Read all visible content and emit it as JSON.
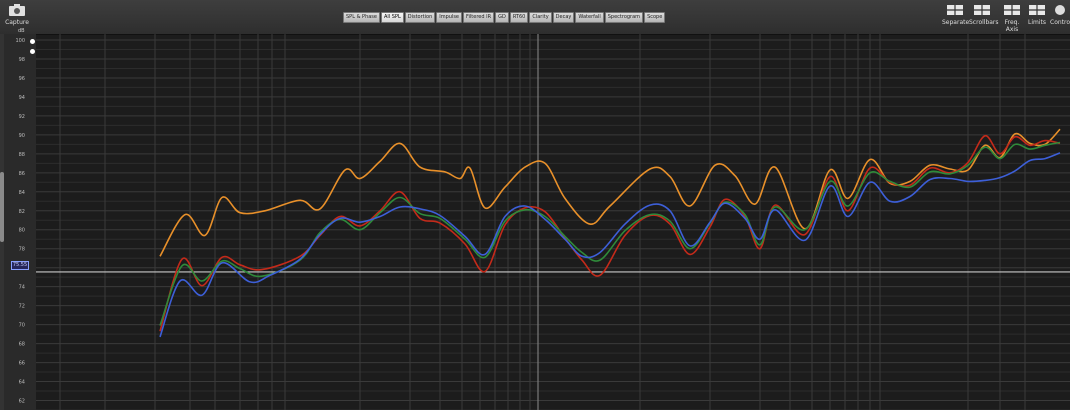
{
  "toolbar": {
    "capture_label": "Capture",
    "tabs": [
      {
        "label": "SPL & Phase"
      },
      {
        "label": "All SPL",
        "active": true
      },
      {
        "label": "Distortion"
      },
      {
        "label": "Impulse"
      },
      {
        "label": "Filtered IR"
      },
      {
        "label": "GD"
      },
      {
        "label": "RT60"
      },
      {
        "label": "Clarity"
      },
      {
        "label": "Decay"
      },
      {
        "label": "Waterfall"
      },
      {
        "label": "Spectrogram"
      },
      {
        "label": "Scope"
      }
    ],
    "right_buttons": [
      {
        "label": "Separate",
        "icon": "separate-icon"
      },
      {
        "label": "Scrollbars",
        "icon": "scrollbars-icon"
      },
      {
        "label": "Freq. Axis",
        "icon": "freq-axis-icon"
      },
      {
        "label": "Limits",
        "icon": "limits-icon"
      },
      {
        "label": "Controls",
        "icon": "controls-icon"
      }
    ]
  },
  "axis": {
    "unit": "dB",
    "ticks": [
      "100",
      "98",
      "96",
      "94",
      "92",
      "90",
      "88",
      "86",
      "84",
      "82",
      "80",
      "78",
      "76",
      "74",
      "72",
      "70",
      "68",
      "66",
      "64",
      "62"
    ],
    "ymax": 100,
    "ymin": 61,
    "cursor_value": "75.55"
  },
  "colors": {
    "orange": "#e8902a",
    "red": "#c42a1a",
    "green": "#2f8a3a",
    "blue": "#3d5fd8",
    "grid": "#3a3a3a",
    "cursor": "#c8c8c8"
  },
  "chart_data": {
    "type": "line",
    "ylabel": "dB",
    "ylim": [
      61,
      100
    ],
    "series": [
      {
        "color": "orange",
        "points": [
          [
            160,
            77.2
          ],
          [
            185,
            81.6
          ],
          [
            205,
            79.4
          ],
          [
            222,
            83.4
          ],
          [
            240,
            81.8
          ],
          [
            265,
            82
          ],
          [
            300,
            83.1
          ],
          [
            320,
            82.2
          ],
          [
            345,
            86.3
          ],
          [
            360,
            85.4
          ],
          [
            380,
            87.2
          ],
          [
            400,
            89.1
          ],
          [
            420,
            86.6
          ],
          [
            445,
            86.1
          ],
          [
            460,
            85.4
          ],
          [
            470,
            86.5
          ],
          [
            485,
            82.3
          ],
          [
            505,
            84.5
          ],
          [
            525,
            86.6
          ],
          [
            545,
            87
          ],
          [
            565,
            83.3
          ],
          [
            590,
            80.6
          ],
          [
            610,
            82.5
          ],
          [
            650,
            86.4
          ],
          [
            670,
            85.6
          ],
          [
            690,
            82.5
          ],
          [
            715,
            86.8
          ],
          [
            735,
            85.7
          ],
          [
            755,
            82.7
          ],
          [
            775,
            86.6
          ],
          [
            805,
            80.1
          ],
          [
            830,
            86.3
          ],
          [
            848,
            83.3
          ],
          [
            870,
            87.4
          ],
          [
            890,
            84.9
          ],
          [
            910,
            85.1
          ],
          [
            930,
            86.8
          ],
          [
            950,
            86.4
          ],
          [
            968,
            86.3
          ],
          [
            985,
            88.9
          ],
          [
            1000,
            87.6
          ],
          [
            1015,
            90.1
          ],
          [
            1030,
            89.1
          ],
          [
            1045,
            89
          ],
          [
            1060,
            90.6
          ]
        ]
      },
      {
        "color": "red",
        "points": [
          [
            160,
            69.3
          ],
          [
            182,
            76.9
          ],
          [
            202,
            74.1
          ],
          [
            222,
            77.1
          ],
          [
            240,
            76.3
          ],
          [
            262,
            75.8
          ],
          [
            300,
            77.2
          ],
          [
            320,
            79.4
          ],
          [
            340,
            81.4
          ],
          [
            360,
            80.4
          ],
          [
            380,
            82
          ],
          [
            400,
            84
          ],
          [
            420,
            81.2
          ],
          [
            440,
            80.7
          ],
          [
            465,
            78.5
          ],
          [
            485,
            75.6
          ],
          [
            505,
            80.5
          ],
          [
            525,
            82.3
          ],
          [
            545,
            81.9
          ],
          [
            565,
            79.1
          ],
          [
            582,
            76.8
          ],
          [
            600,
            75.2
          ],
          [
            625,
            79.4
          ],
          [
            650,
            81.5
          ],
          [
            670,
            80.6
          ],
          [
            690,
            77.4
          ],
          [
            710,
            80.3
          ],
          [
            725,
            83.2
          ],
          [
            745,
            81.4
          ],
          [
            760,
            78
          ],
          [
            775,
            82.6
          ],
          [
            805,
            79.5
          ],
          [
            830,
            85.6
          ],
          [
            848,
            82
          ],
          [
            870,
            86.5
          ],
          [
            890,
            85
          ],
          [
            910,
            84.7
          ],
          [
            930,
            86.5
          ],
          [
            950,
            86
          ],
          [
            968,
            87.1
          ],
          [
            985,
            89.9
          ],
          [
            1000,
            88
          ],
          [
            1015,
            89.8
          ],
          [
            1030,
            88.9
          ],
          [
            1045,
            89.4
          ],
          [
            1060,
            89.1
          ]
        ]
      },
      {
        "color": "green",
        "points": [
          [
            160,
            69.9
          ],
          [
            182,
            76.2
          ],
          [
            202,
            74.6
          ],
          [
            222,
            76.7
          ],
          [
            240,
            75.9
          ],
          [
            262,
            75.1
          ],
          [
            300,
            76.8
          ],
          [
            320,
            79.7
          ],
          [
            340,
            81.1
          ],
          [
            360,
            80
          ],
          [
            380,
            81.8
          ],
          [
            400,
            83.4
          ],
          [
            420,
            81.7
          ],
          [
            440,
            81.2
          ],
          [
            465,
            79
          ],
          [
            485,
            77.1
          ],
          [
            505,
            80.9
          ],
          [
            525,
            82.1
          ],
          [
            545,
            81.4
          ],
          [
            565,
            79.3
          ],
          [
            582,
            77.6
          ],
          [
            600,
            76.8
          ],
          [
            625,
            79.9
          ],
          [
            650,
            81.6
          ],
          [
            670,
            80.9
          ],
          [
            690,
            78
          ],
          [
            710,
            80.7
          ],
          [
            725,
            82.9
          ],
          [
            745,
            81.6
          ],
          [
            760,
            78.4
          ],
          [
            775,
            82.4
          ],
          [
            805,
            80
          ],
          [
            830,
            85.1
          ],
          [
            848,
            82.5
          ],
          [
            870,
            86
          ],
          [
            890,
            85.1
          ],
          [
            910,
            84.5
          ],
          [
            930,
            86.1
          ],
          [
            950,
            85.9
          ],
          [
            968,
            86.8
          ],
          [
            985,
            88.7
          ],
          [
            1000,
            87.5
          ],
          [
            1015,
            89
          ],
          [
            1030,
            88.5
          ],
          [
            1045,
            88.9
          ],
          [
            1060,
            89.2
          ]
        ]
      },
      {
        "color": "blue",
        "points": [
          [
            160,
            68.7
          ],
          [
            180,
            74.6
          ],
          [
            202,
            73.1
          ],
          [
            222,
            76.5
          ],
          [
            250,
            74.5
          ],
          [
            270,
            75.2
          ],
          [
            300,
            76.9
          ],
          [
            320,
            79.5
          ],
          [
            340,
            81.2
          ],
          [
            360,
            80.8
          ],
          [
            380,
            81.4
          ],
          [
            400,
            82.4
          ],
          [
            420,
            82.2
          ],
          [
            440,
            81.5
          ],
          [
            465,
            79.3
          ],
          [
            485,
            77.4
          ],
          [
            505,
            81.4
          ],
          [
            525,
            82.5
          ],
          [
            545,
            81.1
          ],
          [
            565,
            79
          ],
          [
            582,
            77.2
          ],
          [
            600,
            77.6
          ],
          [
            625,
            80.6
          ],
          [
            650,
            82.6
          ],
          [
            670,
            82
          ],
          [
            690,
            78.3
          ],
          [
            710,
            80.8
          ],
          [
            725,
            82.8
          ],
          [
            745,
            81.2
          ],
          [
            760,
            79
          ],
          [
            775,
            82.1
          ],
          [
            805,
            78.9
          ],
          [
            830,
            84.6
          ],
          [
            848,
            81.4
          ],
          [
            870,
            85
          ],
          [
            890,
            83
          ],
          [
            910,
            83.5
          ],
          [
            930,
            85.3
          ],
          [
            950,
            85.4
          ],
          [
            968,
            85.1
          ],
          [
            985,
            85.2
          ],
          [
            1000,
            85.5
          ],
          [
            1015,
            86.2
          ],
          [
            1030,
            87.3
          ],
          [
            1045,
            87.5
          ],
          [
            1060,
            88.1
          ]
        ]
      }
    ]
  }
}
